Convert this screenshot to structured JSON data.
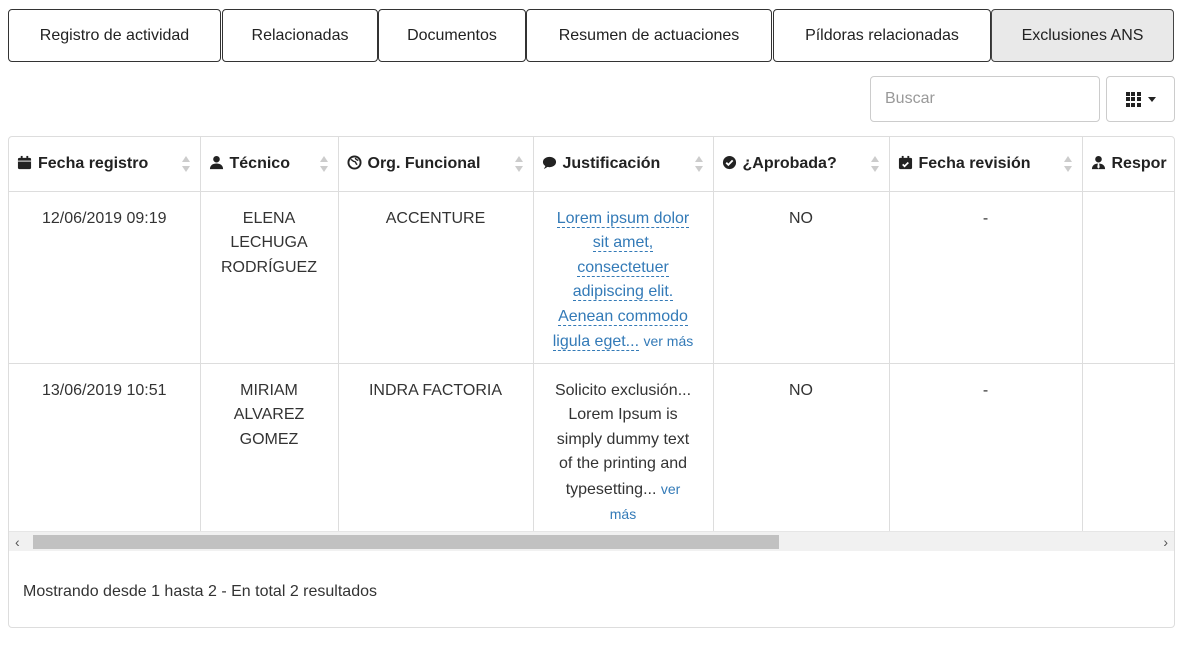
{
  "tabs": [
    {
      "label": "Registro de actividad",
      "active": false
    },
    {
      "label": "Relacionadas",
      "active": false
    },
    {
      "label": "Documentos",
      "active": false
    },
    {
      "label": "Resumen de actuaciones",
      "active": false
    },
    {
      "label": "Píldoras relacionadas",
      "active": false
    },
    {
      "label": "Exclusiones ANS",
      "active": true
    }
  ],
  "toolbar": {
    "search_placeholder": "Buscar",
    "columns_button_icon": "grid-icon"
  },
  "table": {
    "columns": [
      {
        "label": "Fecha registro",
        "icon": "calendar-icon"
      },
      {
        "label": "Técnico",
        "icon": "user-icon"
      },
      {
        "label": "Org. Funcional",
        "icon": "globe-icon"
      },
      {
        "label": "Justificación",
        "icon": "comment-icon"
      },
      {
        "label": "¿Aprobada?",
        "icon": "check-circle-icon"
      },
      {
        "label": "Fecha revisión",
        "icon": "calendar-check-icon"
      },
      {
        "label": "Respor",
        "icon": "user-tie-icon"
      }
    ],
    "rows": [
      {
        "fecha": "12/06/2019 09:19",
        "tecnico": [
          "ELENA",
          "LECHUGA",
          "RODRÍGUEZ"
        ],
        "org": "ACCENTURE",
        "justificacion": [
          "Lorem ipsum dolor",
          "sit amet,",
          "consectetuer",
          "adipiscing elit.",
          "Aenean commodo",
          "ligula eget..."
        ],
        "ver_mas": "ver más",
        "aprobada": "NO",
        "fecha_revision": "-",
        "responsable": ""
      },
      {
        "fecha": "13/06/2019 10:51",
        "tecnico": [
          "MIRIAM",
          "ALVAREZ",
          "GOMEZ"
        ],
        "org": "INDRA FACTORIA",
        "justificacion": [
          "Solicito exclusión...",
          "Lorem Ipsum is",
          "simply dummy text",
          "of the printing and",
          "typesetting..."
        ],
        "ver_mas": "ver",
        "ver_mas_2": "más",
        "aprobada": "NO",
        "fecha_revision": "-",
        "responsable": ""
      }
    ]
  },
  "footer": {
    "summary": "Mostrando desde 1 hasta 2 - En total 2 resultados"
  }
}
